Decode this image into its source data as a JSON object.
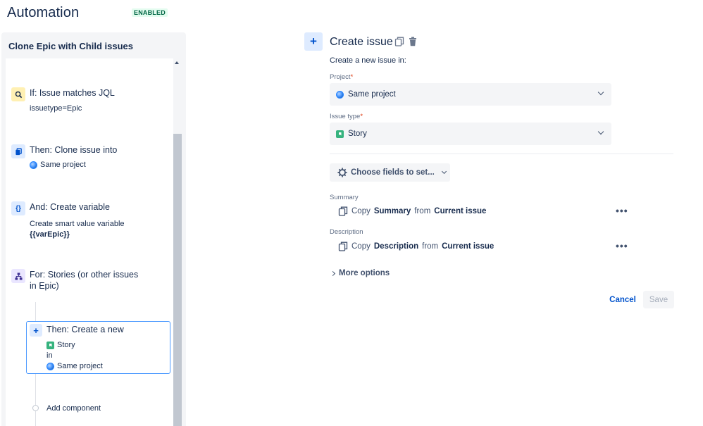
{
  "header": {
    "title": "Automation",
    "status_badge": "ENABLED"
  },
  "rule": {
    "name": "Clone Epic with Child issues",
    "components": [
      {
        "icon": "search-icon",
        "title": "If: Issue matches JQL",
        "detail": "issuetype=Epic"
      },
      {
        "icon": "clone-icon",
        "title": "Then: Clone issue into",
        "detail": "Same project"
      },
      {
        "icon": "variable-icon",
        "title": "And: Create variable",
        "detail": "Create smart value variable",
        "detail2": "{{varEpic}}"
      },
      {
        "icon": "branch-icon",
        "title_line1": "For: Stories (or other issues",
        "title_line2": "in Epic)"
      }
    ],
    "nested": {
      "title": "Then: Create a new",
      "issue_type": "Story",
      "in_label": "in",
      "project": "Same project"
    },
    "add_component_label": "Add component"
  },
  "editor": {
    "title": "Create issue",
    "description": "Create a new issue in:",
    "project_label": "Project",
    "project_value": "Same project",
    "issue_type_label": "Issue type",
    "issue_type_value": "Story",
    "required_marker": "*",
    "choose_fields_label": "Choose fields to set...",
    "fields": [
      {
        "label": "Summary",
        "copy_prefix": "Copy",
        "field": "Summary",
        "from": "from",
        "source": "Current issue",
        "menu": "•••"
      },
      {
        "label": "Description",
        "copy_prefix": "Copy",
        "field": "Description",
        "from": "from",
        "source": "Current issue",
        "menu": "•••"
      }
    ],
    "more_options_label": "More options",
    "cancel_label": "Cancel",
    "save_label": "Save"
  },
  "colors": {
    "accent": "#0052cc",
    "enabled": "#006644",
    "selected_border": "#4c9aff",
    "story": "#36b37e"
  }
}
